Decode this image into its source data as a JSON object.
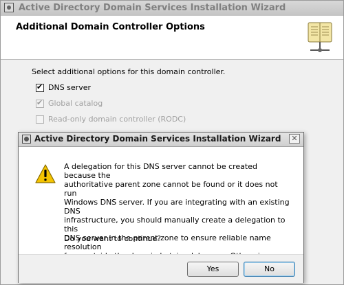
{
  "wizard": {
    "title": "Active Directory Domain Services Installation Wizard",
    "page_title": "Additional Domain Controller Options",
    "intro": "Select additional options for this domain controller.",
    "options": [
      {
        "label": "DNS server",
        "checked": true,
        "enabled": true
      },
      {
        "label": "Global catalog",
        "checked": true,
        "enabled": false
      },
      {
        "label": "Read-only domain controller (RODC)",
        "checked": false,
        "enabled": false
      }
    ]
  },
  "dialog": {
    "title": "Active Directory Domain Services Installation Wizard",
    "close_label": "✕",
    "message": "A delegation for this DNS server cannot be created because the\nauthoritative parent zone cannot be found or it does not run\nWindows DNS server. If you are integrating with an existing DNS\ninfrastructure, you should manually create a delegation to this\nDNS server in the parent zone to ensure reliable name resolution\nfrom outside the domain hotciscolabs.com. Otherwise, no action is\nrequired.",
    "question": "Do you want to continue?",
    "yes_label": "Yes",
    "no_label": "No"
  }
}
